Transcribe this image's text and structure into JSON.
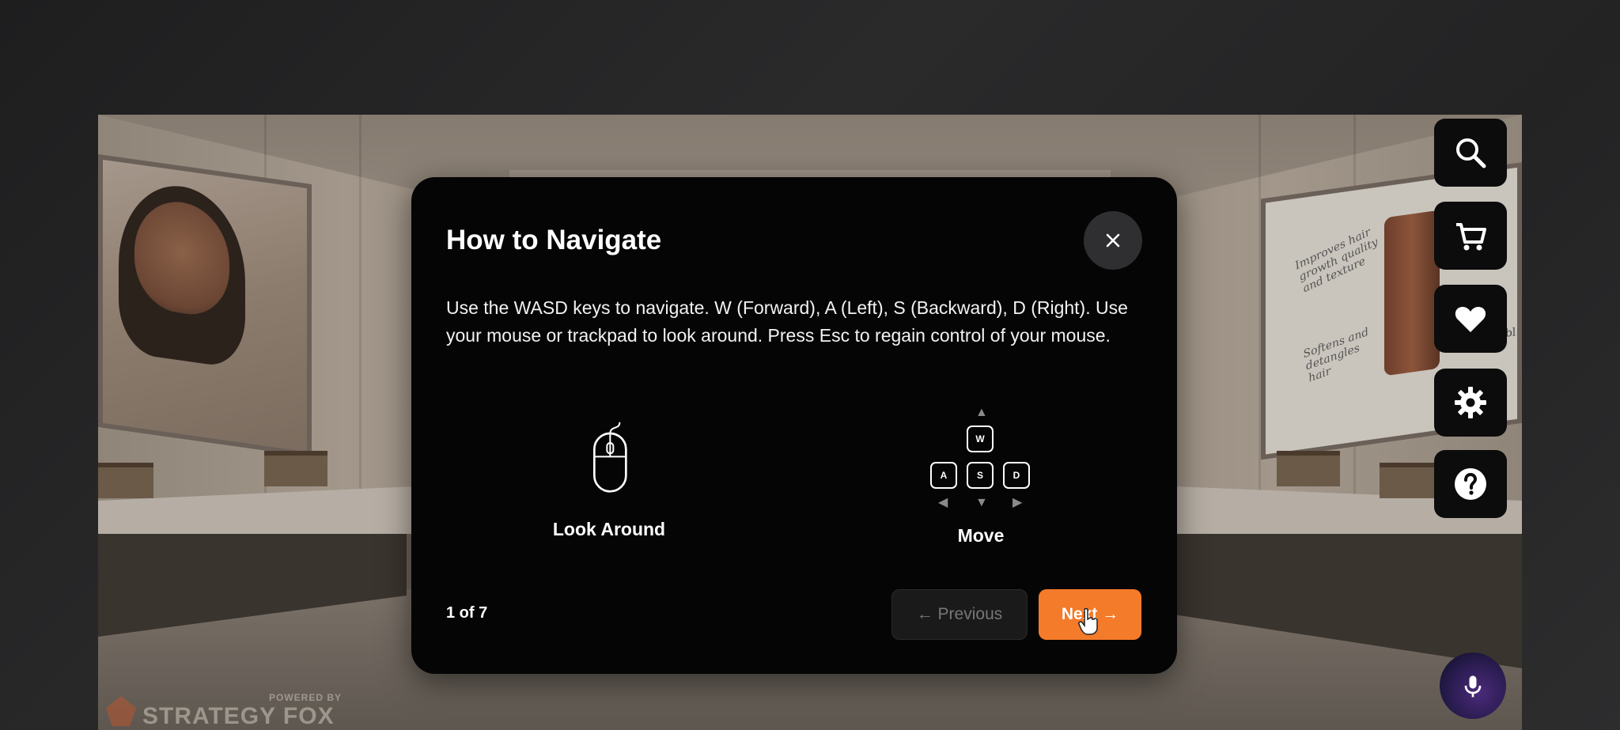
{
  "modal": {
    "title": "How to Navigate",
    "body": "Use the WASD keys to navigate. W (Forward), A (Left), S (Backward), D (Right). Use your mouse or trackpad to look around. Press Esc to regain control of your mouse.",
    "look_label": "Look Around",
    "move_label": "Move",
    "keys": {
      "w": "W",
      "a": "A",
      "s": "S",
      "d": "D"
    },
    "step": "1 of 7",
    "prev_label": "← Previous",
    "next_label": "Next →",
    "close_icon": "close-icon"
  },
  "side_buttons": [
    {
      "name": "search",
      "icon": "search-icon"
    },
    {
      "name": "cart",
      "icon": "cart-icon"
    },
    {
      "name": "wishlist",
      "icon": "heart-icon"
    },
    {
      "name": "settings",
      "icon": "gear-icon"
    },
    {
      "name": "help",
      "icon": "help-icon"
    }
  ],
  "mic": {
    "icon": "microphone-icon"
  },
  "branding": {
    "powered": "POWERED BY",
    "name": "STRATEGY FOX"
  },
  "poster_right": {
    "text1": "Improves hair growth quality and texture",
    "text2": "Softens and detangles hair",
    "text3": "Increases bl"
  },
  "colors": {
    "accent": "#f47b2a",
    "modal_bg": "#050505",
    "side_btn_bg": "#0c0c0c"
  }
}
